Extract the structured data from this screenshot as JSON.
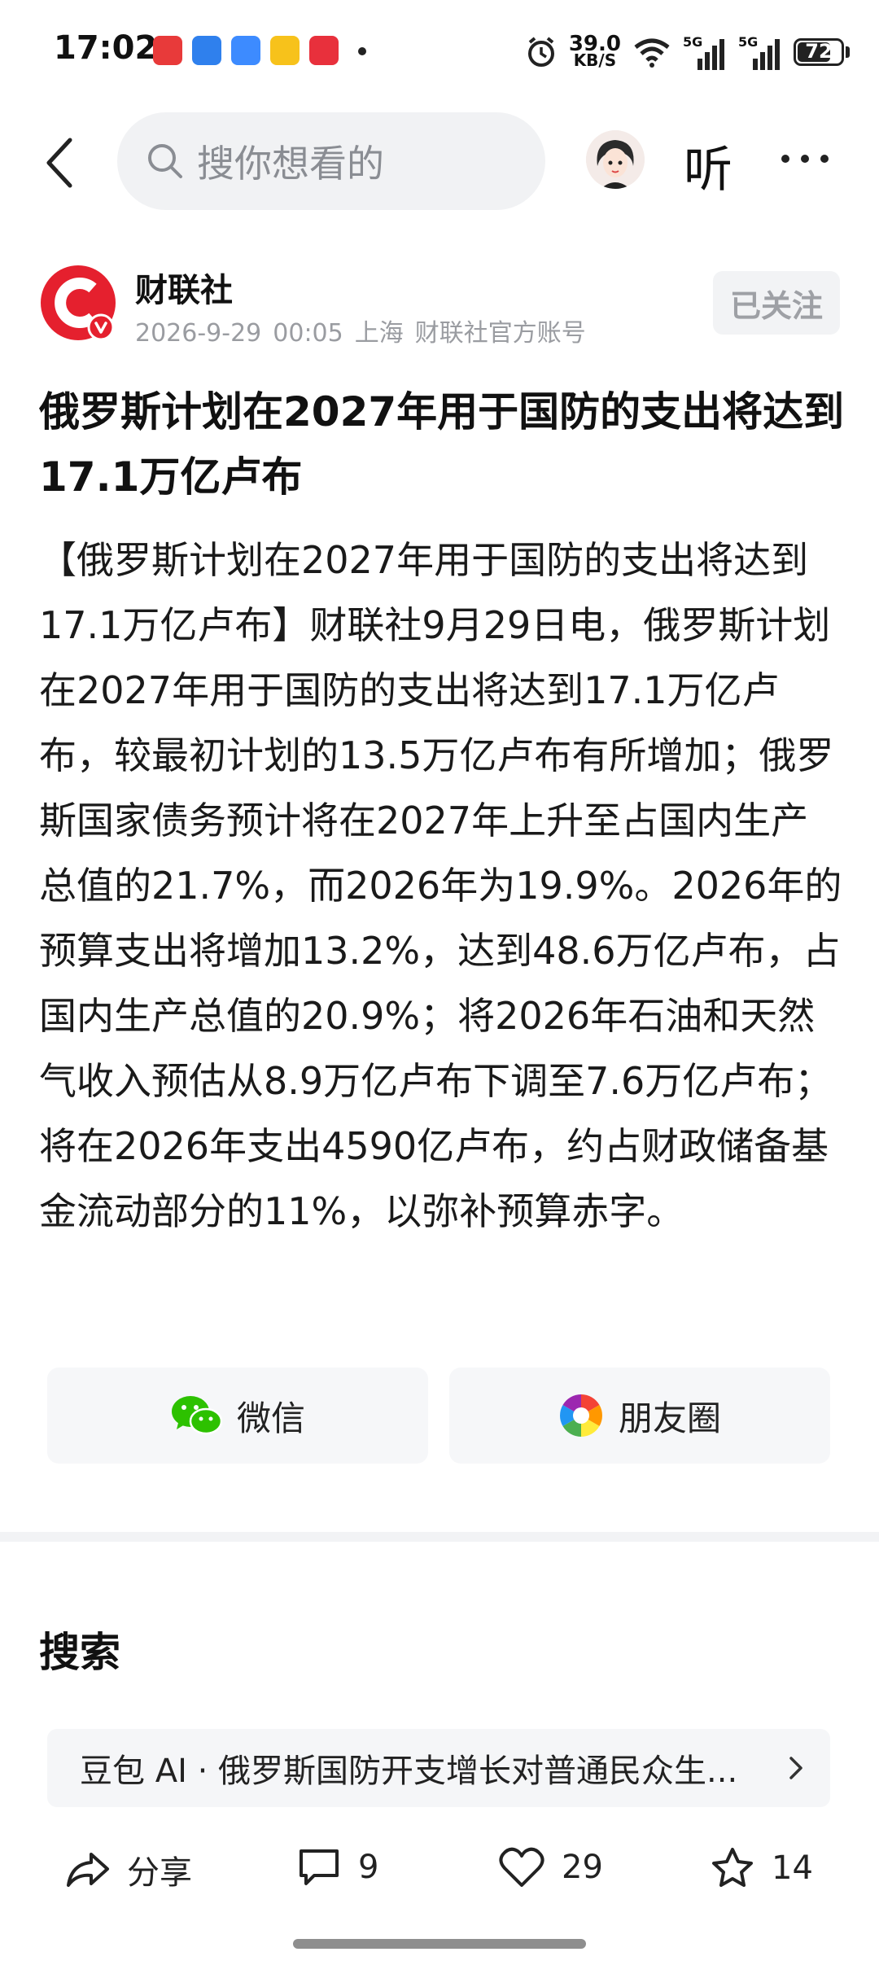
{
  "status_bar": {
    "time": "17:02",
    "net_speed_value": "39.0",
    "net_speed_unit": "KB/S",
    "battery": "72",
    "signal_a": "5G",
    "signal_b": "5G"
  },
  "nav": {
    "search_placeholder": "搜你想看的",
    "listen_label": "听"
  },
  "author": {
    "name": "财联社",
    "date": "2026-9-29",
    "time": "00:05",
    "location": "上海",
    "account_type": "财联社官方账号",
    "follow_label": "已关注"
  },
  "article": {
    "title": "俄罗斯计划在2027年用于国防的支出将达到17.1万亿卢布",
    "body": "【俄罗斯计划在2027年用于国防的支出将达到17.1万亿卢布】财联社9月29日电，俄罗斯计划在2027年用于国防的支出将达到17.1万亿卢布，较最初计划的13.5万亿卢布有所增加；俄罗斯国家债务预计将在2027年上升至占国内生产总值的21.7%，而2026年为19.9%。2026年的预算支出将增加13.2%，达到48.6万亿卢布，占国内生产总值的20.9%；将2026年石油和天然气收入预估从8.9万亿卢布下调至7.6万亿卢布；将在2026年支出4590亿卢布，约占财政储备基金流动部分的11%，以弥补预算赤字。"
  },
  "share": {
    "wechat_label": "微信",
    "moments_label": "朋友圈"
  },
  "search_section": {
    "heading": "搜索",
    "suggestion": "豆包 AI · 俄罗斯国防开支增长对普通民众生..."
  },
  "bottom_bar": {
    "share_label": "分享",
    "comments": "9",
    "likes": "29",
    "favorites": "14"
  },
  "colors": {
    "brand_red": "#e5202e",
    "wechat_green": "#2dc100"
  }
}
